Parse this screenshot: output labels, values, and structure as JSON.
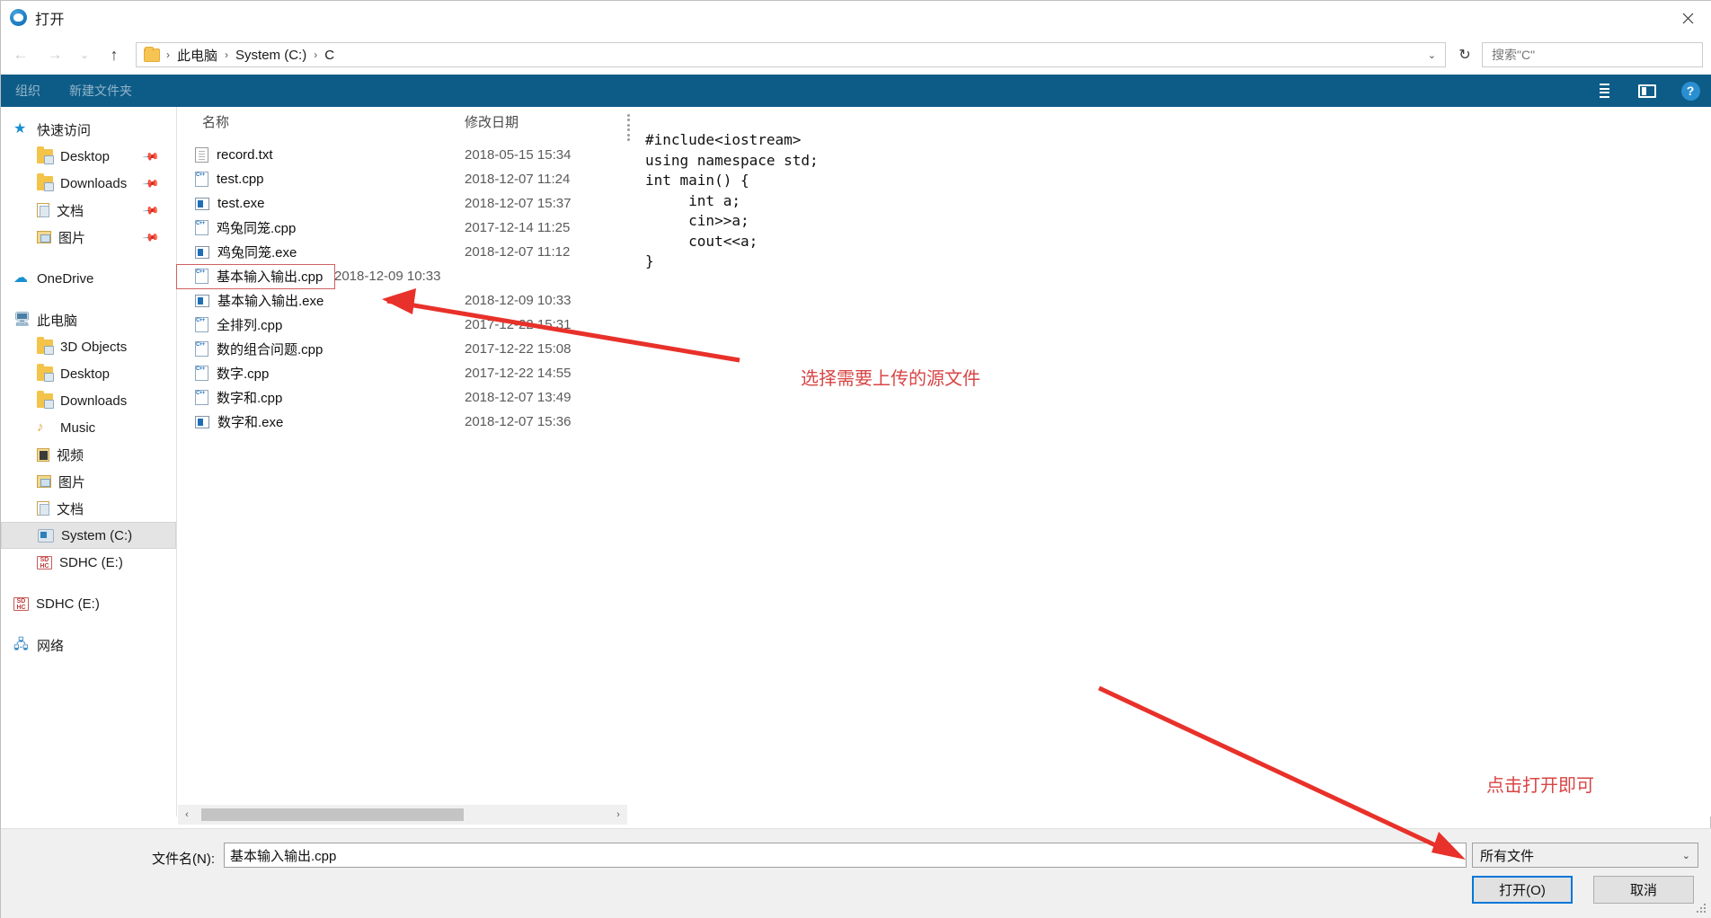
{
  "window": {
    "title": "打开",
    "icon": "app-open-icon",
    "close_label": "✕"
  },
  "nav": {
    "back": "←",
    "forward": "→",
    "recent": "⌄",
    "up": "↑",
    "breadcrumbs": [
      "此电脑",
      "System (C:)",
      "C"
    ],
    "separator": "›",
    "dropdown": "⌄",
    "refresh": "↻",
    "search_placeholder": "搜索\"C\"",
    "search_value": ""
  },
  "commandbar": {
    "items": [
      "组织",
      "新建文件夹"
    ],
    "help_label": "?"
  },
  "sidebar": {
    "groups": [
      {
        "header": {
          "label": "快速访问",
          "icon": "star-icon"
        },
        "items": [
          {
            "label": "Desktop",
            "icon": "folder-desktop-icon",
            "pinned": true
          },
          {
            "label": "Downloads",
            "icon": "folder-downloads-icon",
            "pinned": true
          },
          {
            "label": "文档",
            "icon": "folder-documents-icon",
            "pinned": true
          },
          {
            "label": "图片",
            "icon": "folder-pictures-icon",
            "pinned": true
          }
        ]
      },
      {
        "header": {
          "label": "OneDrive",
          "icon": "cloud-icon"
        },
        "items": []
      },
      {
        "header": {
          "label": "此电脑",
          "icon": "computer-icon"
        },
        "items": [
          {
            "label": "3D Objects",
            "icon": "folder-3dobjects-icon"
          },
          {
            "label": "Desktop",
            "icon": "folder-desktop-icon"
          },
          {
            "label": "Downloads",
            "icon": "folder-downloads-icon"
          },
          {
            "label": "Music",
            "icon": "folder-music-icon"
          },
          {
            "label": "视频",
            "icon": "folder-videos-icon"
          },
          {
            "label": "图片",
            "icon": "folder-pictures-icon"
          },
          {
            "label": "文档",
            "icon": "folder-documents-icon"
          },
          {
            "label": "System (C:)",
            "icon": "drive-icon",
            "selected": true
          },
          {
            "label": "SDHC (E:)",
            "icon": "sd-card-icon"
          }
        ]
      },
      {
        "header": {
          "label": "SDHC (E:)",
          "icon": "sd-card-icon"
        },
        "items": []
      },
      {
        "header": {
          "label": "网络",
          "icon": "network-icon"
        },
        "items": []
      }
    ]
  },
  "filelist": {
    "columns": {
      "name": "名称",
      "date": "修改日期"
    },
    "rows": [
      {
        "name": "record.txt",
        "date": "2018-05-15 15:34",
        "icon": "txt-file-icon",
        "selected": false
      },
      {
        "name": "test.cpp",
        "date": "2018-12-07 11:24",
        "icon": "cpp-file-icon",
        "selected": false
      },
      {
        "name": "test.exe",
        "date": "2018-12-07 15:37",
        "icon": "exe-file-icon",
        "selected": false
      },
      {
        "name": "鸡兔同笼.cpp",
        "date": "2017-12-14 11:25",
        "icon": "cpp-file-icon",
        "selected": false
      },
      {
        "name": "鸡兔同笼.exe",
        "date": "2018-12-07 11:12",
        "icon": "exe-file-icon",
        "selected": false
      },
      {
        "name": "基本输入输出.cpp",
        "date": "2018-12-09 10:33",
        "icon": "cpp-file-icon",
        "selected": true
      },
      {
        "name": "基本输入输出.exe",
        "date": "2018-12-09 10:33",
        "icon": "exe-file-icon",
        "selected": false
      },
      {
        "name": "全排列.cpp",
        "date": "2017-12-22 15:31",
        "icon": "cpp-file-icon",
        "selected": false
      },
      {
        "name": "数的组合问题.cpp",
        "date": "2017-12-22 15:08",
        "icon": "cpp-file-icon",
        "selected": false
      },
      {
        "name": "数字.cpp",
        "date": "2017-12-22 14:55",
        "icon": "cpp-file-icon",
        "selected": false
      },
      {
        "name": "数字和.cpp",
        "date": "2018-12-07 13:49",
        "icon": "cpp-file-icon",
        "selected": false
      },
      {
        "name": "数字和.exe",
        "date": "2018-12-07 15:36",
        "icon": "exe-file-icon",
        "selected": false
      }
    ]
  },
  "preview": {
    "code": "#include<iostream>\nusing namespace std;\nint main() {\n     int a;\n     cin>>a;\n     cout<<a;\n}"
  },
  "scrollbar": {
    "left_arrow": "‹",
    "right_arrow": "›"
  },
  "bottom": {
    "filename_label": "文件名(N):",
    "filename_value": "基本输入输出.cpp",
    "filetype_value": "所有文件",
    "filetype_chevron": "⌄",
    "open_button": "打开(O)",
    "cancel_button": "取消"
  },
  "annotations": [
    {
      "text": "选择需要上传的源文件",
      "color": "#d94545"
    },
    {
      "text": "点击打开即可",
      "color": "#d94545"
    }
  ],
  "colors": {
    "ribbon": "#0d5b87",
    "accent": "#0078d7",
    "annotation": "#d94545",
    "selection_outline": "#d06060",
    "bottom_bg": "#f0f0f0"
  }
}
